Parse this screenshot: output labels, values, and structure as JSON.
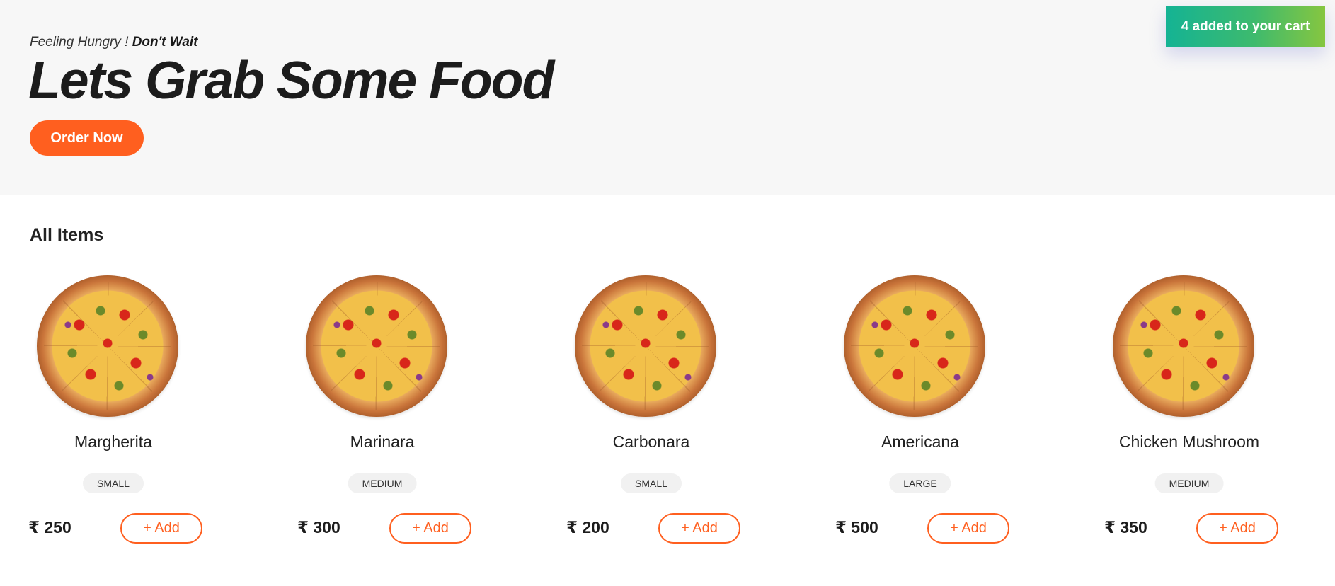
{
  "hero": {
    "tagline_prefix": "Feeling Hungry ! ",
    "tagline_bold": "Don't Wait",
    "headline": "Lets Grab Some Food",
    "order_button": "Order Now"
  },
  "toast": {
    "message": "4 added to your cart"
  },
  "section": {
    "title": "All Items"
  },
  "currency": "₹",
  "add_label": "+ Add",
  "items": [
    {
      "name": "Margherita",
      "size": "SMALL",
      "price": "₹ 250"
    },
    {
      "name": "Marinara",
      "size": "MEDIUM",
      "price": "₹ 300"
    },
    {
      "name": "Carbonara",
      "size": "SMALL",
      "price": "₹ 200"
    },
    {
      "name": "Americana",
      "size": "LARGE",
      "price": "₹ 500"
    },
    {
      "name": "Chicken Mushroom",
      "size": "MEDIUM",
      "price": "₹ 350"
    }
  ],
  "colors": {
    "accent": "#ff5f1f",
    "hero_bg": "#f7f7f7",
    "toast_start": "#14b394",
    "toast_end": "#86c640"
  }
}
